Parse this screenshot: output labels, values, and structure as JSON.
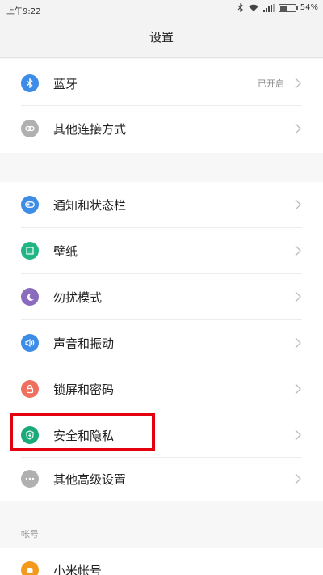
{
  "status_bar": {
    "time": "上午9:22",
    "battery_level_percent": 54,
    "battery_label": "54%",
    "icons": [
      "bluetooth-icon",
      "wifi-icon",
      "signal-icon",
      "battery-icon"
    ]
  },
  "header": {
    "title": "设置"
  },
  "groups": [
    {
      "items": [
        {
          "label": "蓝牙",
          "value": "已开启",
          "icon": "bluetooth-icon",
          "color": "#3d8ce8"
        },
        {
          "label": "其他连接方式",
          "value": "",
          "icon": "link-icon",
          "color": "#b0b0b0"
        }
      ]
    },
    {
      "items": [
        {
          "label": "通知和状态栏",
          "value": "",
          "icon": "notification-icon",
          "color": "#3d8ce8"
        },
        {
          "label": "壁纸",
          "value": "",
          "icon": "wallpaper-icon",
          "color": "#1fb584"
        },
        {
          "label": "勿扰模式",
          "value": "",
          "icon": "moon-icon",
          "color": "#8a6bbd"
        },
        {
          "label": "声音和振动",
          "value": "",
          "icon": "speaker-icon",
          "color": "#3d8ce8"
        },
        {
          "label": "锁屏和密码",
          "value": "",
          "icon": "lock-icon",
          "color": "#ef6f5e"
        },
        {
          "label": "安全和隐私",
          "value": "",
          "icon": "shield-icon",
          "color": "#1aaa7a"
        },
        {
          "label": "其他高级设置",
          "value": "",
          "icon": "more-icon",
          "color": "#b0b0b0"
        }
      ]
    }
  ],
  "account_section": {
    "header": "帐号",
    "items": [
      {
        "label": "小米帐号",
        "value": "",
        "icon": "mi-account-icon",
        "color": "#f39a1c"
      }
    ]
  },
  "highlight_color": "#e4000f"
}
